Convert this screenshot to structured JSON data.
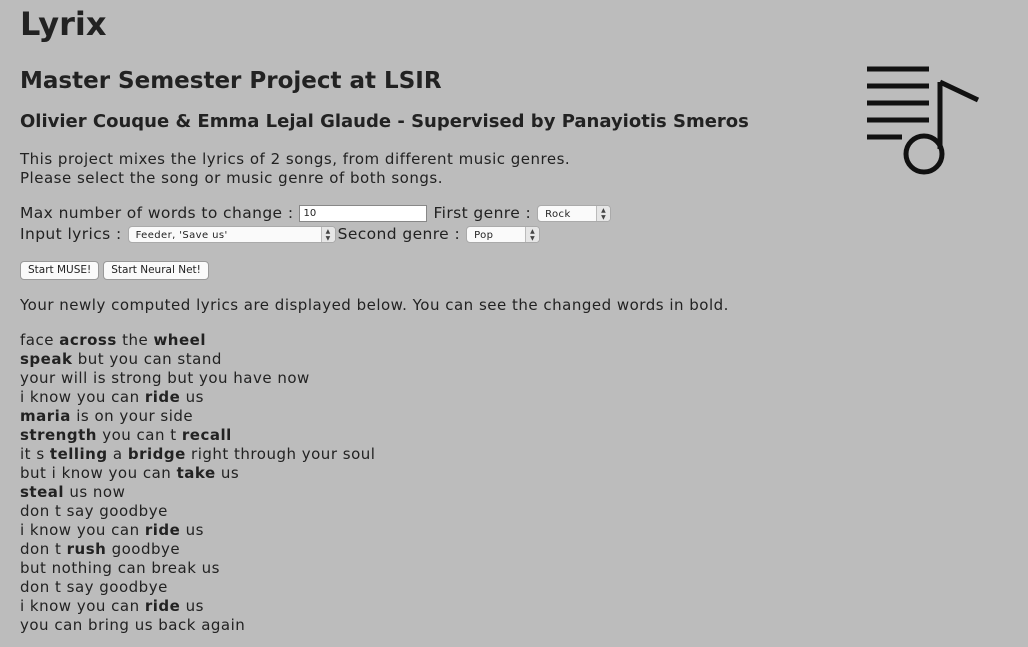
{
  "header": {
    "title": "Lyrix",
    "subtitle": "Master Semester Project at LSIR",
    "authors": "Olivier Couque & Emma Lejal Glaude - Supervised by Panayiotis Smeros"
  },
  "intro": {
    "line1": "This project mixes the lyrics of 2 songs, from different music genres.",
    "line2": "Please select the song or music genre of both songs."
  },
  "form": {
    "max_words_label": "Max number of words to change :",
    "max_words_value": "10",
    "first_genre_label": "First genre :",
    "first_genre_value": "Rock",
    "input_lyrics_label": "Input lyrics :",
    "input_lyrics_value": "Feeder, 'Save us'",
    "second_genre_label": "Second genre :",
    "second_genre_value": "Pop"
  },
  "buttons": {
    "muse": "Start MUSE!",
    "neural": "Start Neural Net!"
  },
  "result_note": "Your newly computed lyrics are displayed below. You can see the changed words in bold.",
  "lyrics": [
    [
      {
        "t": "face "
      },
      {
        "t": "across",
        "b": true
      },
      {
        "t": " the "
      },
      {
        "t": "wheel",
        "b": true
      }
    ],
    [
      {
        "t": "speak",
        "b": true
      },
      {
        "t": " but you can stand"
      }
    ],
    [
      {
        "t": "your will is strong but you have now"
      }
    ],
    [
      {
        "t": "i know you can "
      },
      {
        "t": "ride",
        "b": true
      },
      {
        "t": " us"
      }
    ],
    [
      {
        "t": "maria",
        "b": true
      },
      {
        "t": " is on your side"
      }
    ],
    [
      {
        "t": "strength",
        "b": true
      },
      {
        "t": " you can t "
      },
      {
        "t": "recall",
        "b": true
      }
    ],
    [
      {
        "t": "it s "
      },
      {
        "t": "telling",
        "b": true
      },
      {
        "t": " a "
      },
      {
        "t": "bridge",
        "b": true
      },
      {
        "t": " right through your soul"
      }
    ],
    [
      {
        "t": "but i know you can "
      },
      {
        "t": "take",
        "b": true
      },
      {
        "t": " us"
      }
    ],
    [
      {
        "t": "steal",
        "b": true
      },
      {
        "t": " us now"
      }
    ],
    [
      {
        "t": "don t say goodbye"
      }
    ],
    [
      {
        "t": "i know you can "
      },
      {
        "t": "ride",
        "b": true
      },
      {
        "t": " us"
      }
    ],
    [
      {
        "t": "don t "
      },
      {
        "t": "rush",
        "b": true
      },
      {
        "t": " goodbye"
      }
    ],
    [
      {
        "t": "but nothing can break us"
      }
    ],
    [
      {
        "t": "don t say goodbye"
      }
    ],
    [
      {
        "t": "i know you can "
      },
      {
        "t": "ride",
        "b": true
      },
      {
        "t": " us"
      }
    ],
    [
      {
        "t": "you can bring us back again"
      }
    ]
  ],
  "icons": {
    "logo": "playlist-music-note-icon",
    "select_arrows": "chevron-up-down-icon"
  },
  "colors": {
    "background": "#bcbcbc",
    "text": "#222222"
  }
}
